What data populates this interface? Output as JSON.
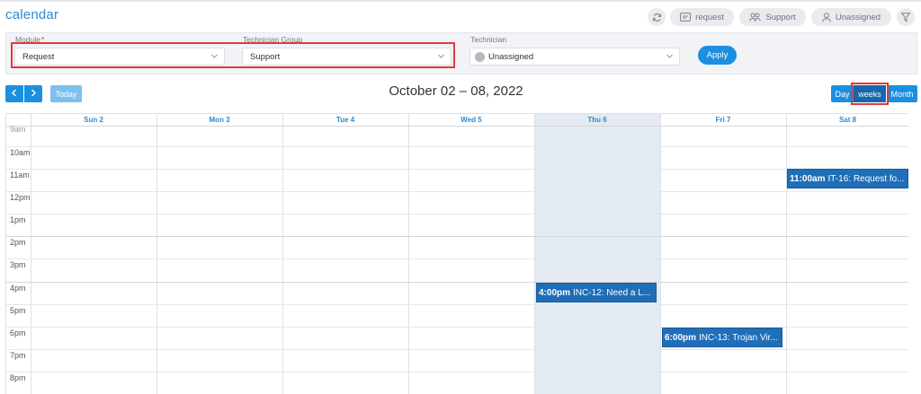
{
  "app": {
    "title": "calendar"
  },
  "top_actions": {
    "request_label": "request",
    "support_label": "Support",
    "unassigned_label": "Unassigned"
  },
  "filters": {
    "module": {
      "label": "Module",
      "required_mark": "*",
      "value": "Request"
    },
    "technician_group": {
      "label": "Technician Group",
      "value": "Support"
    },
    "technician": {
      "label": "Technician",
      "value": "Unassigned"
    },
    "apply_label": "Apply"
  },
  "toolbar": {
    "today_label": "Today",
    "range_title": "October 02 – 08, 2022",
    "views": [
      "Day",
      "weeks",
      "Month"
    ],
    "active_view": "weeks"
  },
  "calendar": {
    "days": [
      "Sun 2",
      "Mon 3",
      "Tue 4",
      "Wed 5",
      "Thu 6",
      "Fri 7",
      "Sat 8"
    ],
    "today_index": 4,
    "times": [
      "9am",
      "10am",
      "11am",
      "12pm",
      "1pm",
      "2pm",
      "3pm",
      "4pm",
      "5pm",
      "6pm",
      "7pm",
      "8pm"
    ],
    "events": [
      {
        "day": "Sat 8",
        "time": "11:00am",
        "title": "IT-16: Request fo..."
      },
      {
        "day": "Thu 6",
        "time": "4:00pm",
        "title": "INC-12: Need a L..."
      },
      {
        "day": "Fri 7",
        "time": "6:00pm",
        "title": "INC-13: Trojan Vir..."
      }
    ]
  },
  "colors": {
    "accent": "#1b8fe0",
    "title_blue": "#2a8bd0",
    "event_bg": "#1f6eb8",
    "today_bg": "#e4ebf2",
    "highlight_red": "#e0393e"
  }
}
